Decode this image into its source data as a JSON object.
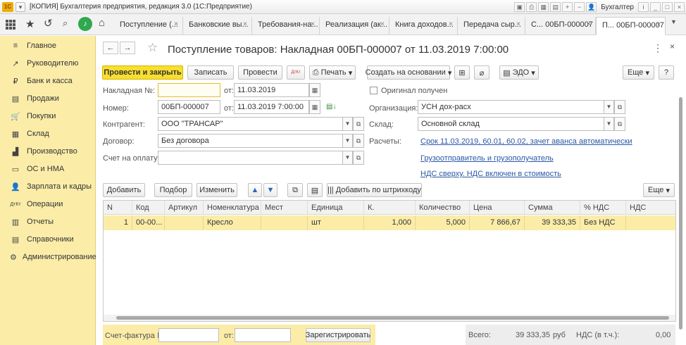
{
  "window": {
    "title": "[КОПИЯ] Бухгалтерия предприятия, редакция 3.0 (1С:Предприятие)",
    "user": "Бухгалтер",
    "logo_text": "1С"
  },
  "tabs": [
    {
      "label": "Поступление (..."
    },
    {
      "label": "Банковские вы..."
    },
    {
      "label": "Требования-на..."
    },
    {
      "label": "Реализация (ак..."
    },
    {
      "label": "Книга доходов..."
    },
    {
      "label": "Передача сыр..."
    },
    {
      "label": "С... 00БП-000007"
    },
    {
      "label": "П... 00БП-000007"
    }
  ],
  "sidebar": {
    "items": [
      {
        "label": "Главное",
        "icon": "≡"
      },
      {
        "label": "Руководителю",
        "icon": "↗"
      },
      {
        "label": "Банк и касса",
        "icon": "₽"
      },
      {
        "label": "Продажи",
        "icon": "▤"
      },
      {
        "label": "Покупки",
        "icon": "🛒"
      },
      {
        "label": "Склад",
        "icon": "▦"
      },
      {
        "label": "Производство",
        "icon": "▟"
      },
      {
        "label": "ОС и НМА",
        "icon": "▭"
      },
      {
        "label": "Зарплата и кадры",
        "icon": "👤"
      },
      {
        "label": "Операции",
        "icon": "ДтКт"
      },
      {
        "label": "Отчеты",
        "icon": "▥"
      },
      {
        "label": "Справочники",
        "icon": "▤"
      },
      {
        "label": "Администрирование",
        "icon": "⚙"
      }
    ]
  },
  "document": {
    "title": "Поступление товаров: Накладная 00БП-000007 от 11.03.2019 7:00:00"
  },
  "toolbar": {
    "post_close": "Провести и закрыть",
    "save": "Записать",
    "post": "Провести",
    "dtkt": "ДтКт",
    "print": "Печать",
    "create_based": "Создать на основании",
    "edo": "ЭДО",
    "more": "Еще"
  },
  "form": {
    "invoice_label": "Накладная №:",
    "invoice_value": "",
    "from_label": "от:",
    "invoice_date": "11.03.2019",
    "original_received": "Оригинал получен",
    "number_label": "Номер:",
    "number_value": "00БП-000007",
    "number_date": "11.03.2019  7:00:00",
    "org_label": "Организация:",
    "org_value": "УСН дох-расх",
    "contractor_label": "Контрагент:",
    "contractor_value": "ООО \"ТРАНСАР\"",
    "warehouse_label": "Склад:",
    "warehouse_value": "Основной склад",
    "contract_label": "Договор:",
    "contract_value": "Без договора",
    "settlements_label": "Расчеты:",
    "settlements_link": "Срок 11.03.2019, 60.01, 60.02, зачет аванса автоматически",
    "payment_label": "Счет на оплату:",
    "payment_value": "",
    "shipper_link": "Грузоотправитель и грузополучатель",
    "vat_link": "НДС сверху. НДС включен в стоимость"
  },
  "table_toolbar": {
    "add": "Добавить",
    "select": "Подбор",
    "change": "Изменить",
    "add_barcode": "Добавить по штрихкоду",
    "more": "Еще"
  },
  "table": {
    "columns": [
      "N",
      "Код",
      "Артикул",
      "Номенклатура",
      "Мест",
      "Единица",
      "К.",
      "Количество",
      "Цена",
      "Сумма",
      "% НДС",
      "НДС"
    ],
    "rows": [
      [
        "1",
        "00-00...",
        "",
        "Кресло",
        "",
        "шт",
        "1,000",
        "5,000",
        "7 866,67",
        "39 333,35",
        "Без НДС",
        ""
      ]
    ]
  },
  "footer": {
    "invoice_label": "Счет-фактура №:",
    "from_label": "от:",
    "register": "Зарегистрировать",
    "total_label": "Всего:",
    "total_value": "39 333,35",
    "currency": "руб",
    "vat_label": "НДС (в т.ч.):",
    "vat_value": "0,00"
  }
}
